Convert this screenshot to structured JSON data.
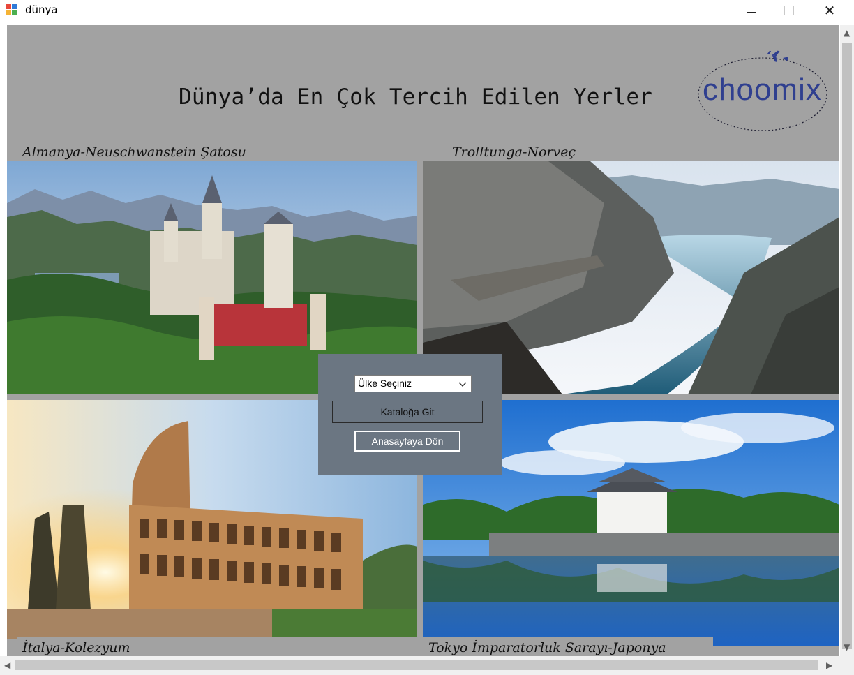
{
  "window": {
    "title": "dünya",
    "controls": {
      "minimize": "minimize",
      "maximize": "maximize",
      "close": "close"
    }
  },
  "header": {
    "title": "Dünya’da En Çok Tercih Edilen Yerler",
    "logo_text": "choomix"
  },
  "places": [
    {
      "caption": "Almanya-Neuschwanstein Şatosu"
    },
    {
      "caption": "Trolltunga-Norveç"
    },
    {
      "caption": "İtalya-Kolezyum"
    },
    {
      "caption": "Tokyo İmparatorluk Sarayı-Japonya"
    }
  ],
  "panel": {
    "country_select": {
      "selected": "Ülke Seçiniz"
    },
    "catalog_button": "Kataloğa Git",
    "home_button": "Anasayfaya Dön"
  },
  "colors": {
    "form_background": "#a2a2a2",
    "panel_background": "#6b7682",
    "logo": "#2f3f8f"
  }
}
